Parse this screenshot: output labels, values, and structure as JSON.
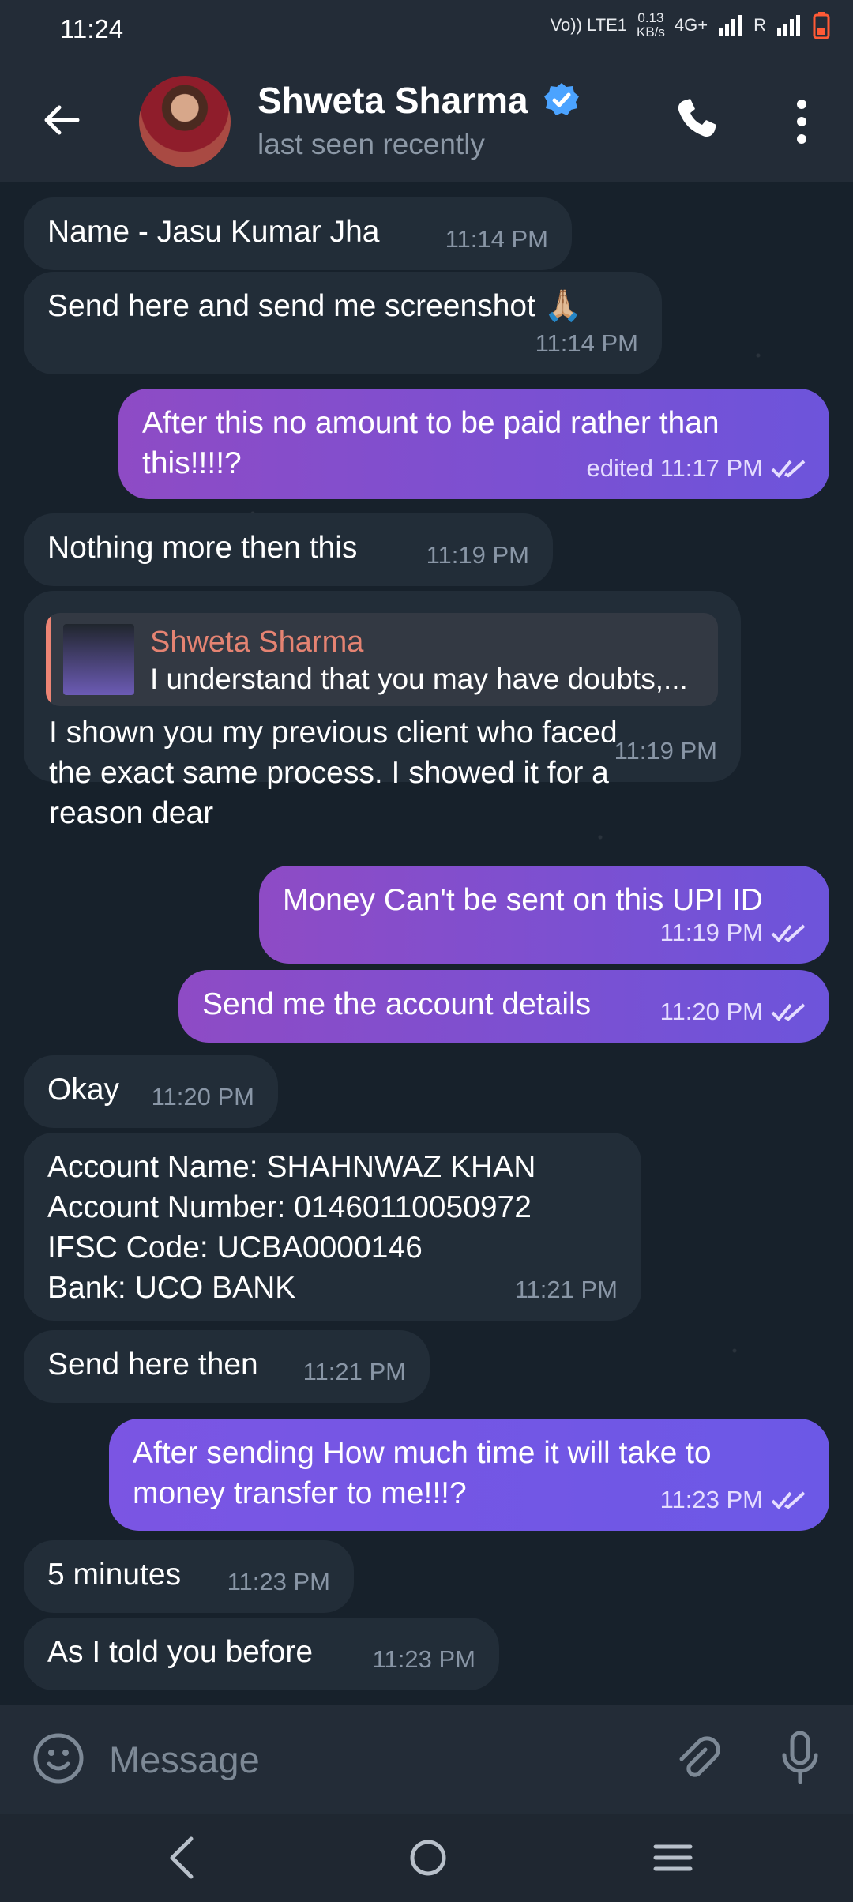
{
  "status_bar": {
    "time": "11:24",
    "volte": "Vo)) LTE1",
    "speed": "0.13",
    "speed_unit": "KB/s",
    "network": "4G+",
    "roaming": "R"
  },
  "header": {
    "name": "Shweta Sharma",
    "status": "last seen recently"
  },
  "messages": [
    {
      "text": "Name - Jasu Kumar Jha",
      "time": "11:14 PM"
    },
    {
      "text": "Send here and send me screenshot 🙏🏼",
      "time": "11:14 PM"
    },
    {
      "text": "After this no amount to be paid rather than\nthis!!!!?",
      "time": "edited 11:17 PM"
    },
    {
      "text": "Nothing more then this",
      "time": "11:19 PM"
    },
    {
      "reply_name": "Shweta Sharma",
      "reply_text": "I understand that you may have doubts,...",
      "text": "I shown you my previous client who faced\nthe exact same process. I showed it for a\nreason dear",
      "time": "11:19 PM"
    },
    {
      "text": "Money Can't be sent on this UPI ID",
      "time": "11:19 PM"
    },
    {
      "text": "Send me the account details",
      "time": "11:20 PM"
    },
    {
      "text": "Okay",
      "time": "11:20 PM"
    },
    {
      "text": "Account Name: SHAHNWAZ KHAN\nAccount Number: 01460110050972\nIFSC Code: UCBA0000146\nBank: UCO BANK",
      "time": "11:21 PM"
    },
    {
      "text": "Send here then",
      "time": "11:21 PM"
    },
    {
      "text": "After sending How much time it will take to\nmoney transfer to me!!!?",
      "time": "11:23 PM"
    },
    {
      "text": "5 minutes",
      "time": "11:23 PM"
    },
    {
      "text": "As I told you before",
      "time": "11:23 PM"
    }
  ],
  "composer": {
    "placeholder": "Message"
  },
  "colors": {
    "accent": "#5b7cf2",
    "incoming": "#222d38",
    "outgoing": "#7c4fd6",
    "header": "#232c37"
  }
}
